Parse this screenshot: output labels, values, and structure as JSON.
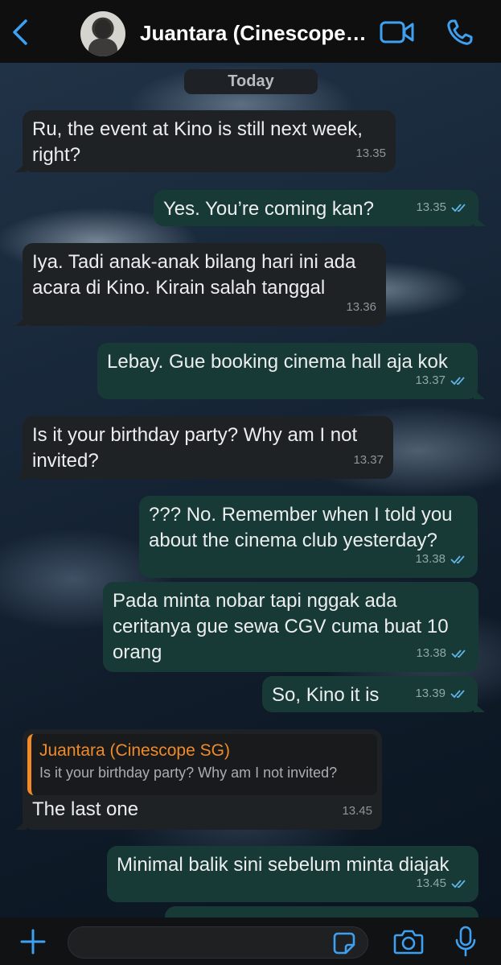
{
  "header": {
    "back_label": "Back",
    "contact_name": "Juantara (Cinescope…"
  },
  "date_chip": "Today",
  "messages": [
    {
      "direction": "in",
      "text": "Ru, the event at Kino is still next week, right?",
      "time": "13.35"
    },
    {
      "direction": "out",
      "text": "Yes. You’re coming kan?",
      "time": "13.35",
      "status": "read"
    },
    {
      "direction": "in",
      "text": "Iya. Tadi anak-anak bilang hari ini ada acara di Kino. Kirain salah tanggal",
      "time": "13.36"
    },
    {
      "direction": "out",
      "text": "Lebay. Gue booking cinema hall aja kok",
      "time": "13.37",
      "status": "read"
    },
    {
      "direction": "in",
      "text": "Is it your birthday party? Why am I not invited?",
      "time": "13.37"
    },
    {
      "direction": "out",
      "text": "??? No. Remember when I told you about the cinema club yesterday?",
      "time": "13.38",
      "status": "read"
    },
    {
      "direction": "out",
      "text": "Pada minta nobar tapi nggak ada ceritanya gue sewa CGV cuma buat 10 orang",
      "time": "13.38",
      "status": "read"
    },
    {
      "direction": "out",
      "text": "So, Kino it is",
      "time": "13.39",
      "status": "read"
    },
    {
      "direction": "in",
      "text": "The last one",
      "time": "13.45",
      "reply": {
        "name": "Juantara (Cinescope SG)",
        "text": "Is it your birthday party? Why am I not invited?"
      }
    },
    {
      "direction": "out",
      "text": "Minimal balik sini sebelum minta diajak",
      "time": "13.45",
      "status": "read"
    }
  ],
  "composer": {
    "placeholder": ""
  },
  "colors": {
    "incoming_bubble": "#1f2224",
    "outgoing_bubble": "#173a36",
    "reply_accent": "#f08a2a",
    "read_ticks": "#5fb4e6"
  }
}
